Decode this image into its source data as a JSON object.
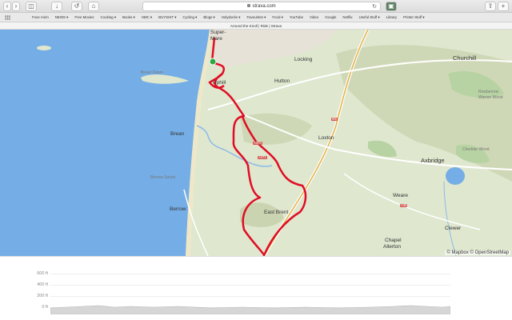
{
  "browser": {
    "url": "strava.com",
    "page_title": "Around the Knoll | Ride | Strava"
  },
  "bookmarks": [
    "Foxe Anim",
    "NEWS ▾",
    "Free Movies",
    "Cooking ▾",
    "Books ▾",
    "HMC ▾",
    "BUYSHIT ▾",
    "Cycling ▾",
    "Blogs ▾",
    "Holydocks ▾",
    "Favourites ▾",
    "Food ▾",
    "YouTube",
    "Video",
    "Google",
    "Netflix",
    "Useful Stuff ▾",
    "Library",
    "Printer Stuff ▾"
  ],
  "map": {
    "places": {
      "super": "Super-",
      "mare": "Mare",
      "uphill": "Uphill",
      "locking": "Locking",
      "churchill": "Churchill",
      "hutton": "Hutton",
      "loxton": "Loxton",
      "brean": "Brean",
      "axbridge": "Axbridge",
      "berrow": "Berrow",
      "weare": "Weare",
      "east_brent": "East Brent",
      "clewer": "Clewer",
      "chapel": "Chapel",
      "allerton": "Allerton",
      "cheddar_wood": "Cheddar Wood",
      "rowberrow": "Rowberrow",
      "warren_wood": "Warren Wood",
      "brean_down": "Brean Down",
      "berrow_sands": "Berrow Sands"
    },
    "roads": {
      "a370": "A370",
      "a371": "A371",
      "a38": "A38",
      "m5": "M5"
    },
    "attribution": "© Mapbox © OpenStreetMap"
  },
  "elevation": {
    "y_labels": [
      "600 ft",
      "400 ft",
      "200 ft",
      "0 ft"
    ]
  }
}
